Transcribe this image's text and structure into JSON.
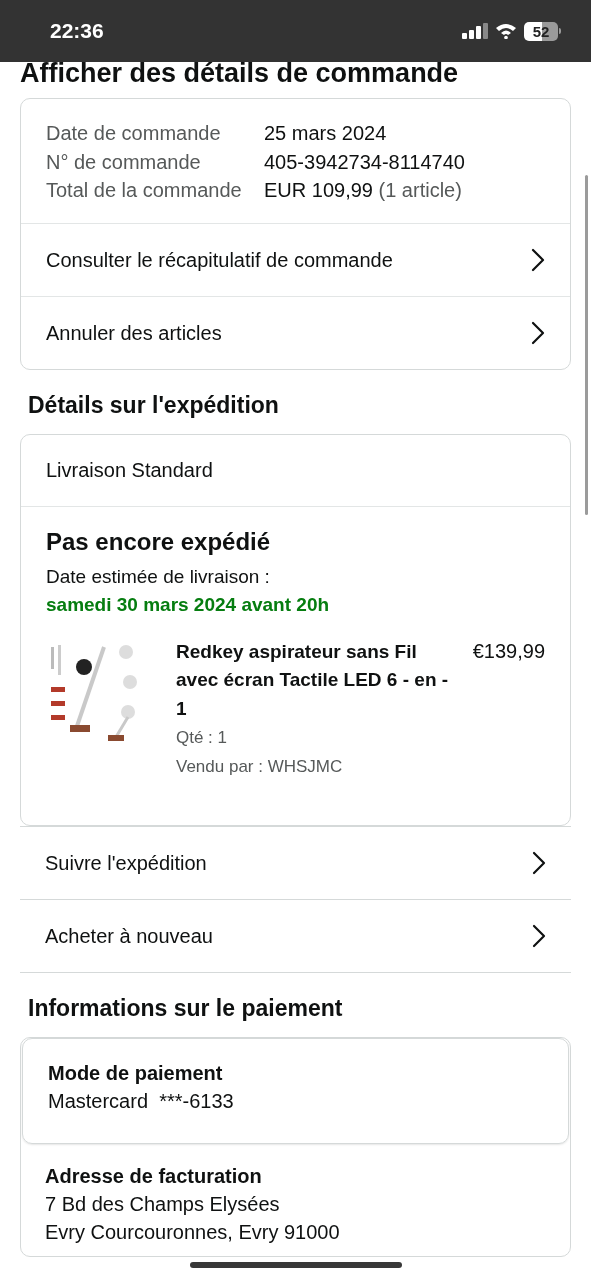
{
  "status_bar": {
    "time": "22:36",
    "battery": "52"
  },
  "title": "Afficher des détails de commande",
  "order_summary": {
    "fields": [
      {
        "label": "Date de commande",
        "value": "25 mars 2024"
      },
      {
        "label": "N° de commande",
        "value": "405-3942734-8114740"
      },
      {
        "label": "Total de la commande",
        "value": "EUR 109,99",
        "note": "(1 article)"
      }
    ],
    "links": [
      {
        "label": "Consulter le récapitulatif de commande"
      },
      {
        "label": "Annuler des articles"
      }
    ]
  },
  "shipping": {
    "heading": "Détails sur l'expédition",
    "method": "Livraison Standard",
    "status": "Pas encore expédié",
    "estimate_label": "Date estimée de livraison :",
    "estimate_date": "samedi 30 mars 2024 avant 20h",
    "items": [
      {
        "title": "Redkey aspirateur sans Fil avec écran Tactile LED 6 - en - 1",
        "price": "€139,99",
        "qty": "Qté : 1",
        "seller": "Vendu par : WHSJMC"
      }
    ],
    "actions": [
      {
        "label": "Suivre l'expédition"
      },
      {
        "label": "Acheter à nouveau"
      }
    ]
  },
  "payment": {
    "heading": "Informations sur le paiement",
    "method": {
      "heading": "Mode de paiement",
      "value": "Mastercard  ***-6133"
    },
    "billing": {
      "heading": "Adresse de facturation",
      "lines": [
        "7 Bd des Champs Elysées",
        "Evry Courcouronnes, Evry 91000"
      ]
    }
  }
}
